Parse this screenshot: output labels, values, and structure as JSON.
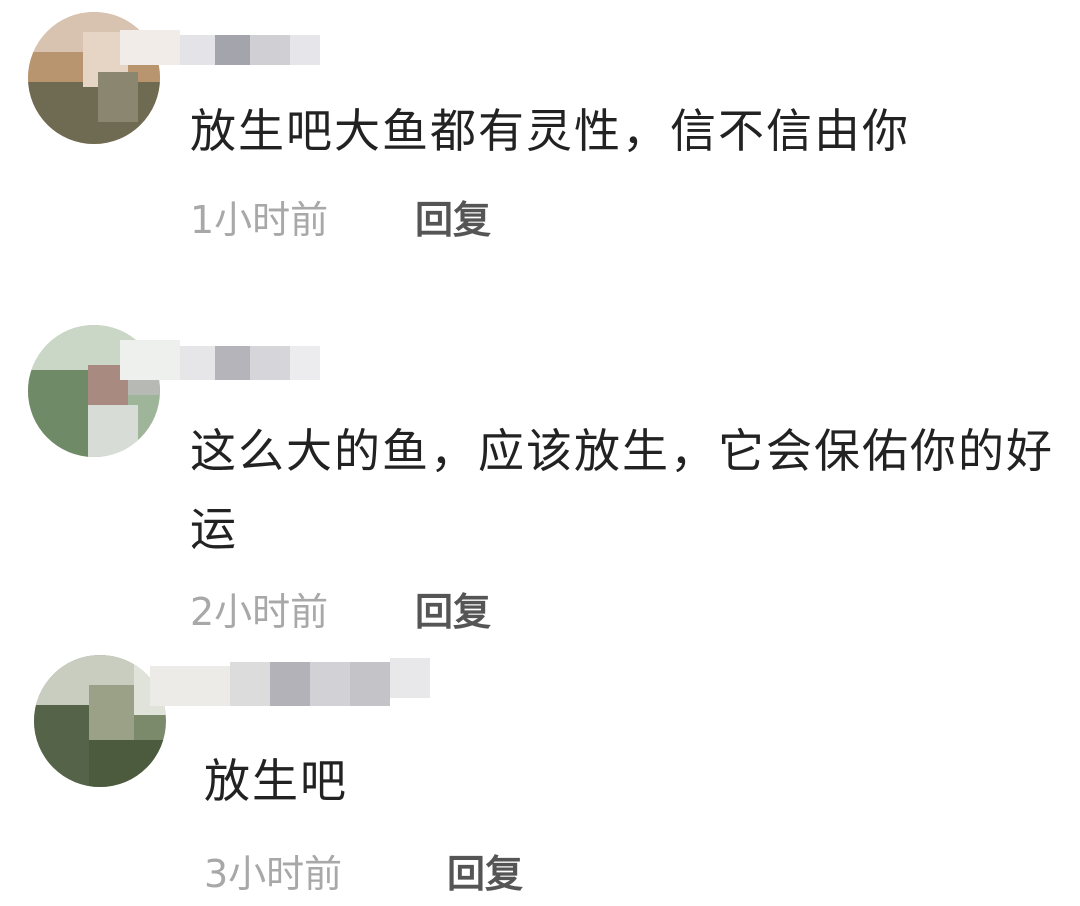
{
  "comments": [
    {
      "text": "放生吧大鱼都有灵性，信不信由你",
      "time": "1小时前",
      "reply_label": "回复"
    },
    {
      "text": "这么大的鱼，应该放生，它会保佑你的好运",
      "time": "2小时前",
      "reply_label": "回复"
    },
    {
      "text": "放生吧",
      "time": "3小时前",
      "reply_label": "回复"
    }
  ]
}
